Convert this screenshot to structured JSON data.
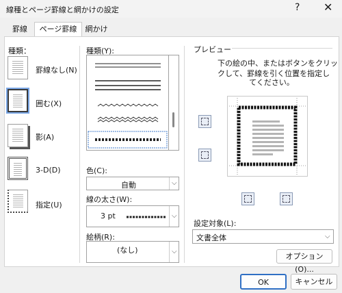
{
  "window": {
    "title": "線種とページ罫線と網かけの設定",
    "help_label": "?",
    "close_label": "✕"
  },
  "tabs": [
    {
      "label": "罫線"
    },
    {
      "label": "ページ罫線"
    },
    {
      "label": "網かけ"
    }
  ],
  "settings": {
    "header": "種類：",
    "items": [
      {
        "label": "罫線なし(N)"
      },
      {
        "label": "囲む(X)",
        "selected": true
      },
      {
        "label": "影(A)"
      },
      {
        "label": "3-D(D)"
      },
      {
        "label": "指定(U)"
      }
    ]
  },
  "style": {
    "label": "種類(Y):",
    "color_label": "色(C):",
    "color_value": "自動",
    "width_label": "線の太さ(W):",
    "width_value": "3 pt",
    "art_label": "絵柄(R):",
    "art_value": "(なし)"
  },
  "preview": {
    "label": "プレビュー",
    "instruction": [
      "下の絵の中、またはボタンをクリッ",
      "クして、罫線を引く位置を指定し",
      "てください。"
    ]
  },
  "apply_to": {
    "label": "設定対象(L):",
    "value": "文書全体"
  },
  "buttons": {
    "options": "オプション(O)...",
    "ok": "OK",
    "cancel": "キャンセル"
  },
  "icons": [
    "border-top-icon",
    "border-bottom-icon",
    "border-left-icon",
    "border-right-icon",
    "chevron-down-icon"
  ]
}
